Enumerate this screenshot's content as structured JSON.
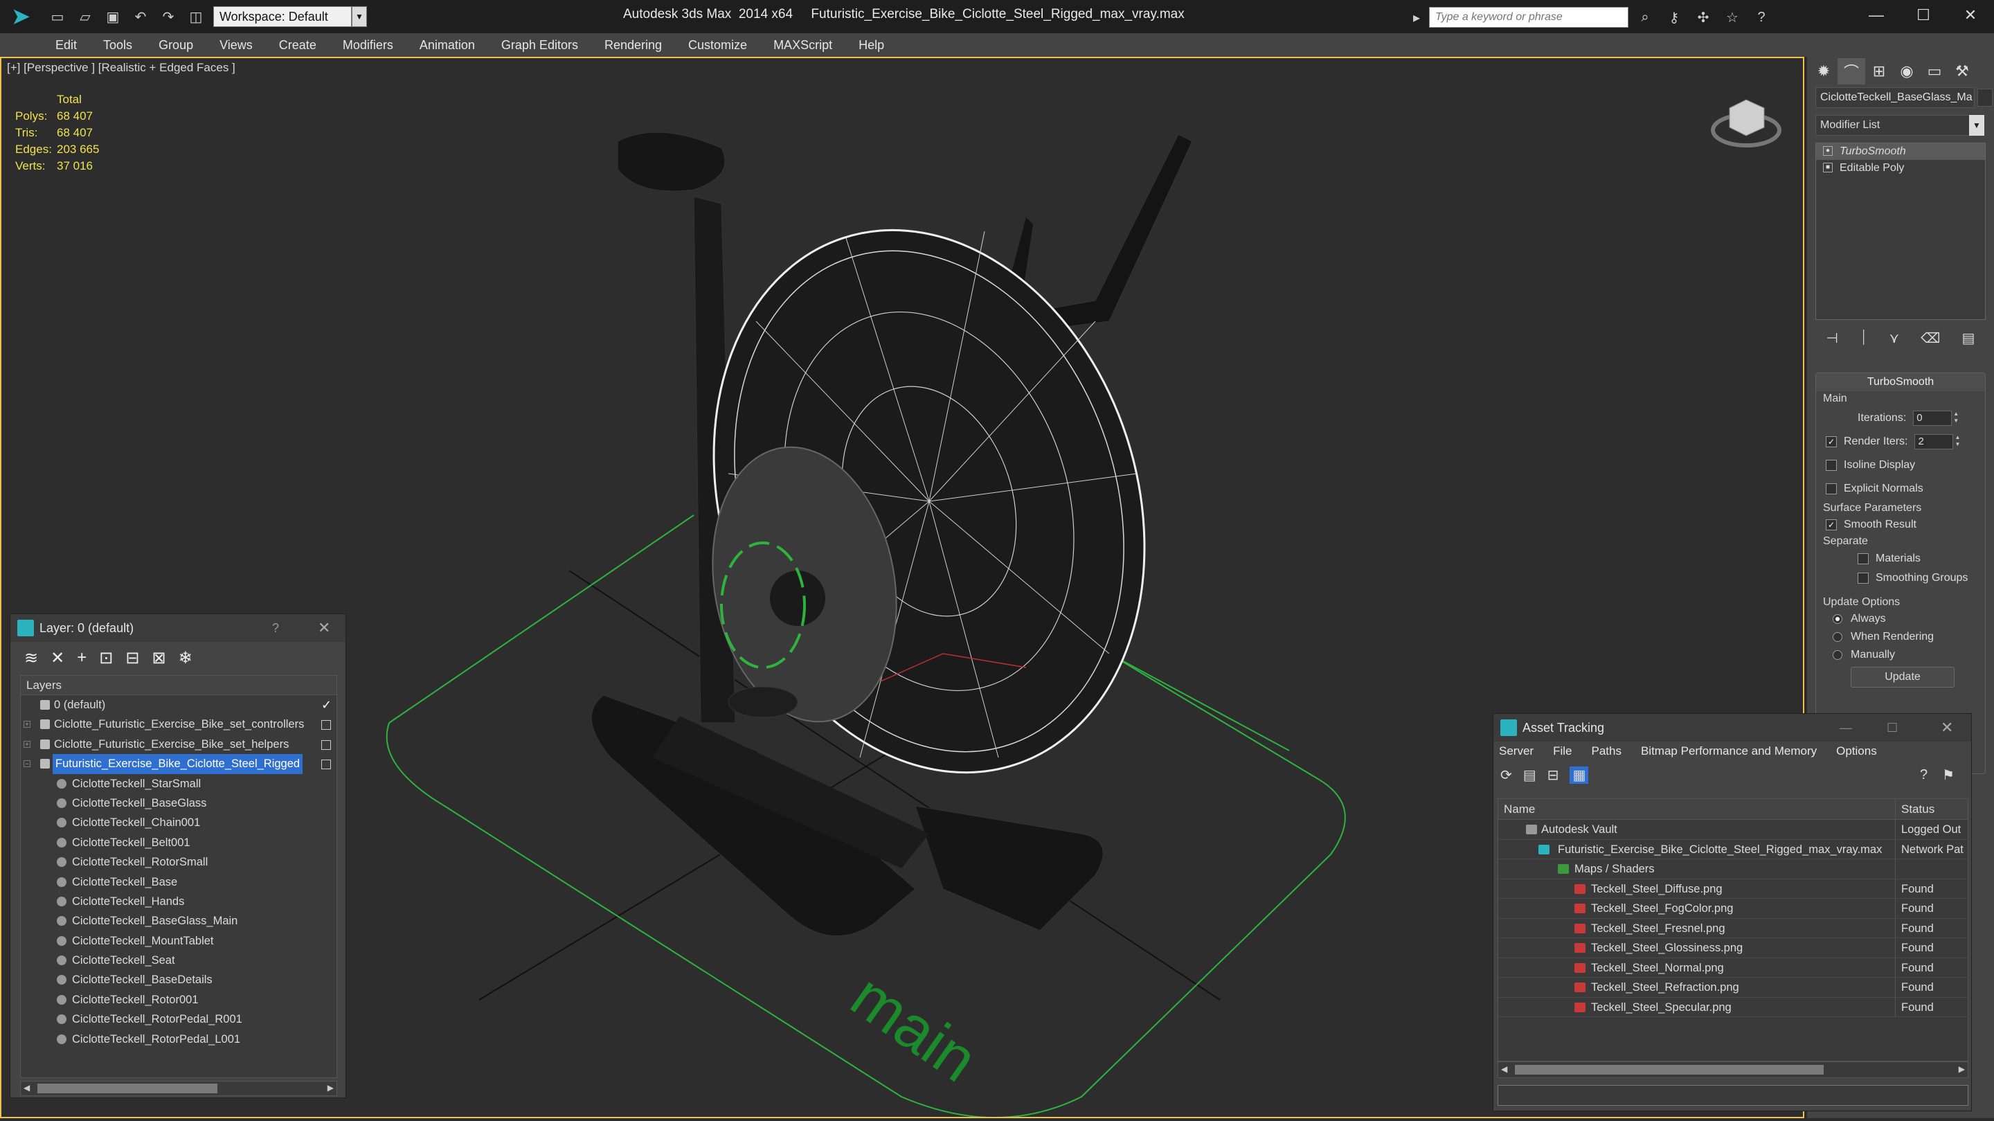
{
  "title_bar": {
    "app_logo": "3ds-max-logo",
    "workspace": "Workspace: Default",
    "window_title": "Autodesk 3ds Max  2014 x64     Futuristic_Exercise_Bike_Ciclotte_Steel_Rigged_max_vray.max",
    "search_placeholder": "Type a keyword or phrase"
  },
  "menu": [
    "Edit",
    "Tools",
    "Group",
    "Views",
    "Create",
    "Modifiers",
    "Animation",
    "Graph Editors",
    "Rendering",
    "Customize",
    "MAXScript",
    "Help"
  ],
  "viewport": {
    "label": "[+] [Perspective ] [Realistic + Edged Faces ]",
    "stats": {
      "header": "Total",
      "rows": [
        {
          "label": "Polys:",
          "value": "68 407"
        },
        {
          "label": "Tris:",
          "value": "68 407"
        },
        {
          "label": "Edges:",
          "value": "203 665"
        },
        {
          "label": "Verts:",
          "value": "37 016"
        }
      ]
    },
    "ground_text": "main"
  },
  "command_panel": {
    "object_name": "CiclotteTeckell_BaseGlass_Ma",
    "modifier_list": "Modifier List",
    "stack": [
      "TurboSmooth",
      "Editable Poly"
    ],
    "turbosmooth": {
      "title": "TurboSmooth",
      "main_label": "Main",
      "iterations_label": "Iterations:",
      "iterations_value": "0",
      "render_iters_label": "Render Iters:",
      "render_iters_value": "2",
      "isoline": "Isoline Display",
      "explicit": "Explicit Normals",
      "surface_label": "Surface Parameters",
      "smooth_result": "Smooth Result",
      "separate_label": "Separate",
      "materials": "Materials",
      "smoothing_groups": "Smoothing Groups",
      "update_label": "Update Options",
      "always": "Always",
      "when_rendering": "When Rendering",
      "manually": "Manually",
      "update_button": "Update"
    }
  },
  "layer_manager": {
    "title": "Layer: 0 (default)",
    "help": "?",
    "column_header": "Layers",
    "layers": [
      {
        "name": "0 (default)",
        "check": "✓"
      },
      {
        "name": "Ciclotte_Futuristic_Exercise_Bike_set_controllers",
        "check": ""
      },
      {
        "name": "Ciclotte_Futuristic_Exercise_Bike_set_helpers",
        "check": ""
      },
      {
        "name": "Futuristic_Exercise_Bike_Ciclotte_Steel_Rigged",
        "check": ""
      }
    ],
    "objects": [
      "CiclotteTeckell_StarSmall",
      "CiclotteTeckell_BaseGlass",
      "CiclotteTeckell_Chain001",
      "CiclotteTeckell_Belt001",
      "CiclotteTeckell_RotorSmall",
      "CiclotteTeckell_Base",
      "CiclotteTeckell_Hands",
      "CiclotteTeckell_BaseGlass_Main",
      "CiclotteTeckell_MountTablet",
      "CiclotteTeckell_Seat",
      "CiclotteTeckell_BaseDetails",
      "CiclotteTeckell_Rotor001",
      "CiclotteTeckell_RotorPedal_R001",
      "CiclotteTeckell_RotorPedal_L001"
    ]
  },
  "asset_tracking": {
    "title": "Asset Tracking",
    "menu": [
      "Server",
      "File",
      "Paths",
      "Bitmap Performance and Memory",
      "Options"
    ],
    "columns": {
      "name": "Name",
      "status": "Status"
    },
    "rows": [
      {
        "name": "Autodesk Vault",
        "status": "Logged Out",
        "indent": 1
      },
      {
        "name": "Futuristic_Exercise_Bike_Ciclotte_Steel_Rigged_max_vray.max",
        "status": "Network Pat",
        "indent": 2
      },
      {
        "name": "Maps / Shaders",
        "status": "",
        "indent": 3
      },
      {
        "name": "Teckell_Steel_Diffuse.png",
        "status": "Found",
        "indent": 4
      },
      {
        "name": "Teckell_Steel_FogColor.png",
        "status": "Found",
        "indent": 4
      },
      {
        "name": "Teckell_Steel_Fresnel.png",
        "status": "Found",
        "indent": 4
      },
      {
        "name": "Teckell_Steel_Glossiness.png",
        "status": "Found",
        "indent": 4
      },
      {
        "name": "Teckell_Steel_Normal.png",
        "status": "Found",
        "indent": 4
      },
      {
        "name": "Teckell_Steel_Refraction.png",
        "status": "Found",
        "indent": 4
      },
      {
        "name": "Teckell_Steel_Specular.png",
        "status": "Found",
        "indent": 4
      }
    ]
  },
  "colors": {
    "selection": "#2f6fcf",
    "stats": "#f2e24a",
    "viewport_border": "#f2c14b",
    "grid_green": "#2fb33f"
  }
}
